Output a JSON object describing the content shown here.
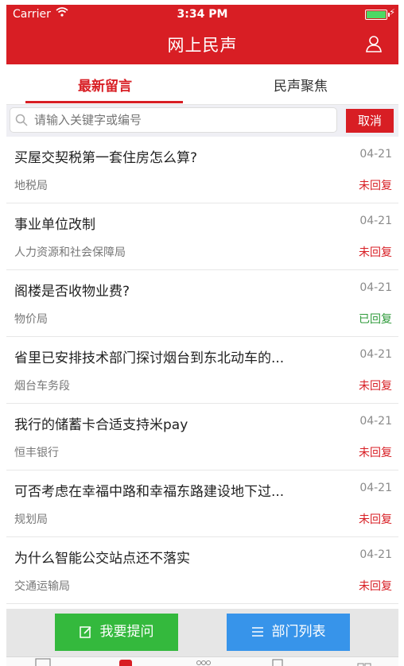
{
  "status_bar": {
    "carrier": "Carrier",
    "time": "3:34 PM"
  },
  "header": {
    "title": "网上民声"
  },
  "tabs": [
    {
      "label": "最新留言"
    },
    {
      "label": "民声聚焦"
    }
  ],
  "search": {
    "placeholder": "请输入关键字或编号",
    "cancel_label": "取消"
  },
  "messages": [
    {
      "question": "买屋交契税第一套住房怎么算?",
      "date": "04-21",
      "department": "地税局",
      "status": "未回复"
    },
    {
      "question": "事业单位改制",
      "date": "04-21",
      "department": "人力资源和社会保障局",
      "status": "未回复"
    },
    {
      "question": "阁楼是否收物业费?",
      "date": "04-21",
      "department": "物价局",
      "status": "已回复"
    },
    {
      "question": "省里已安排技术部门探讨烟台到东北动车的...",
      "date": "04-21",
      "department": "烟台车务段",
      "status": "未回复"
    },
    {
      "question": "我行的储蓄卡合适支持米pay",
      "date": "04-21",
      "department": "恒丰银行",
      "status": "未回复"
    },
    {
      "question": "可否考虑在幸福中路和幸福东路建设地下过...",
      "date": "04-21",
      "department": "规划局",
      "status": "未回复"
    },
    {
      "question": "为什么智能公交站点还不落实",
      "date": "04-21",
      "department": "交通运输局",
      "status": "未回复"
    }
  ],
  "actions": {
    "ask_label": "我要提问",
    "dept_list_label": "部门列表"
  },
  "colors": {
    "brand": "#d81e24",
    "replied": "#2e9a3a",
    "ask_button": "#34b93d",
    "dept_button": "#3794ea"
  }
}
